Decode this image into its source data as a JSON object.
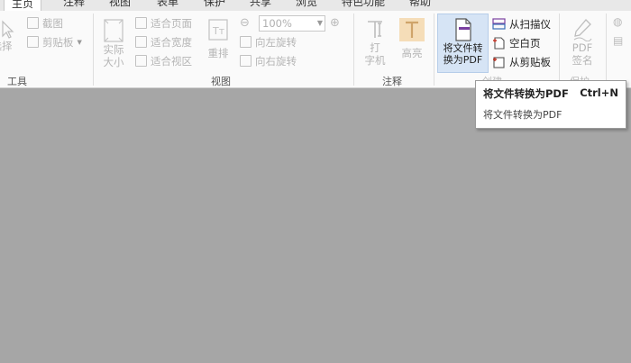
{
  "tabs": [
    {
      "label": "主页",
      "active": true
    },
    {
      "label": "注释"
    },
    {
      "label": "视图"
    },
    {
      "label": "表单"
    },
    {
      "label": "保护"
    },
    {
      "label": "共享"
    },
    {
      "label": "浏览"
    },
    {
      "label": "特色功能"
    },
    {
      "label": "帮助"
    }
  ],
  "tools": {
    "select_label": "选择",
    "screenshot_label": "截图",
    "clipboard_label": "剪贴板",
    "group_label": "工具"
  },
  "view": {
    "actual_size_label": "实际\n大小",
    "fit_page_label": "适合页面",
    "fit_width_label": "适合宽度",
    "fit_visible_label": "适合视区",
    "reflow_label": "重排",
    "zoom_value": "100%",
    "rotate_left_label": "向左旋转",
    "rotate_right_label": "向右旋转",
    "group_label": "视图"
  },
  "annotate": {
    "typewriter_label": "打\n字机",
    "highlight_label": "高亮",
    "group_label": "注释"
  },
  "create": {
    "convert_label": "将文件转\n换为PDF",
    "from_scanner_label": "从扫描仪",
    "blank_page_label": "空白页",
    "from_clipboard_label": "从剪贴板",
    "group_label": "创建"
  },
  "protect": {
    "pdf_sign_label": "PDF\n签名",
    "group_label": "保护"
  },
  "tooltip": {
    "title": "将文件转换为PDF",
    "shortcut": "Ctrl+N",
    "description": "将文件转换为PDF"
  },
  "colors": {
    "accent": "#7a3fa0",
    "ribbon_bg": "#fafafa",
    "workspace_bg": "#a6a6a6",
    "highlight_bg": "#d6e4f5"
  }
}
